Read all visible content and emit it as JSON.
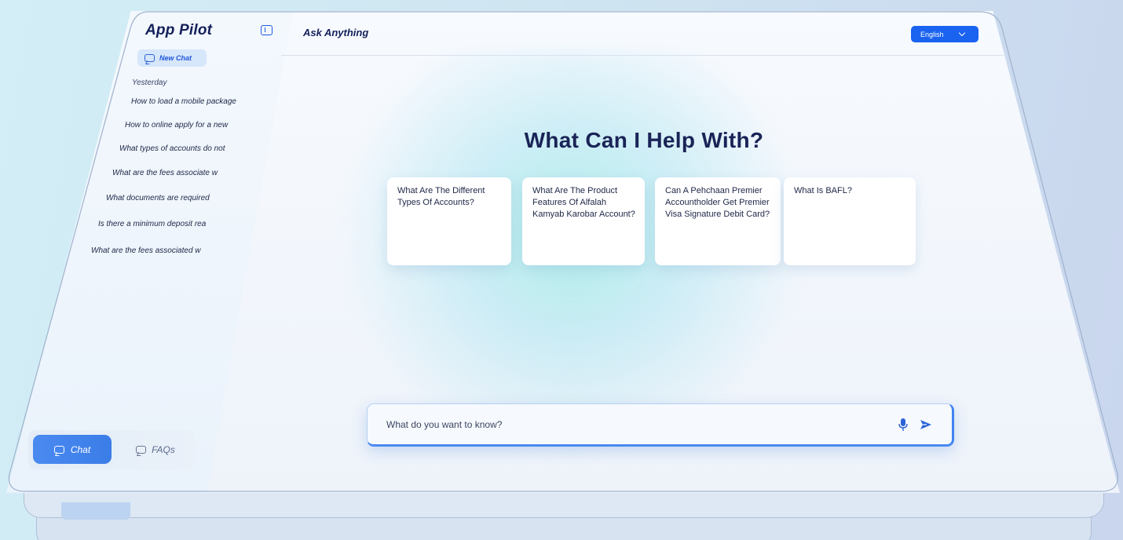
{
  "sidebar": {
    "brand": "App Pilot",
    "new_chat_label": "New Chat",
    "section_label": "Yesterday",
    "history": [
      "How to load a mobile package",
      "How to online apply for a new",
      "What types of accounts do not",
      "What are the fees associate w",
      "What documents are required",
      "Is there a minimum deposit rea",
      "What are the fees associated w"
    ],
    "nav": {
      "chat_label": "Chat",
      "faqs_label": "FAQs"
    }
  },
  "header": {
    "title": "Ask Anything",
    "language": "English"
  },
  "main": {
    "headline": "What Can I Help With?",
    "suggestions": [
      "What Are The Different Types Of Accounts?",
      "What Are The Product Features Of Alfalah Kamyab Karobar Account?",
      "Can A Pehchaan Premier Accountholder Get Premier Visa Signature Debit Card?",
      "What Is BAFL?"
    ],
    "search": {
      "placeholder": "What do you want to know?"
    }
  },
  "colors": {
    "accent": "#1a62f0",
    "heading": "#1a2457",
    "nav_active": "#3b7de8"
  },
  "icons": [
    "collapse-sidebar-icon",
    "new-chat-icon",
    "chevron-down-icon",
    "chat-icon",
    "faq-icon",
    "microphone-icon",
    "send-icon"
  ]
}
